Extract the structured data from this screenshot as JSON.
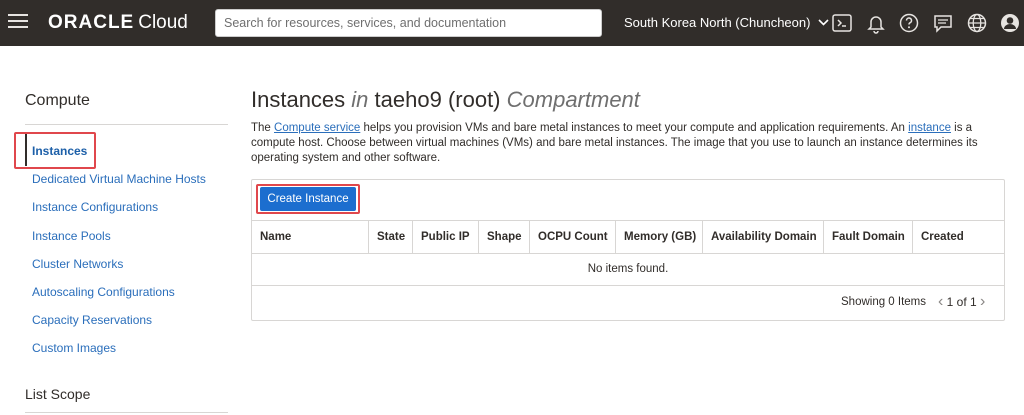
{
  "header": {
    "brand": "ORACLE",
    "product": "Cloud",
    "search_placeholder": "Search for resources, services, and documentation",
    "region": "South Korea North (Chuncheon)",
    "icons": [
      "cloud-shell-icon",
      "bell-icon",
      "help-icon",
      "chat-icon",
      "globe-icon",
      "profile-icon"
    ]
  },
  "sidebar": {
    "title": "Compute",
    "items": [
      {
        "label": "Instances",
        "active": true
      },
      {
        "label": "Dedicated Virtual Machine Hosts"
      },
      {
        "label": "Instance Configurations"
      },
      {
        "label": "Instance Pools"
      },
      {
        "label": "Cluster Networks"
      },
      {
        "label": "Autoscaling Configurations"
      },
      {
        "label": "Capacity Reservations"
      },
      {
        "label": "Custom Images"
      }
    ],
    "scope_title": "List Scope"
  },
  "main": {
    "title_a": "Instances",
    "title_in": "in",
    "title_b": "taeho9 (root)",
    "title_c": "Compartment",
    "desc_1": "The ",
    "desc_link_1": "Compute service",
    "desc_2": " helps you provision VMs and bare metal instances to meet your compute and application requirements. An ",
    "desc_link_2": "instance",
    "desc_3": " is a compute host. Choose between virtual machines (VMs) and bare metal instances. The image that you use to launch an instance determines its operating system and other software.",
    "create_button": "Create Instance",
    "columns": [
      "Name",
      "State",
      "Public IP",
      "Shape",
      "OCPU Count",
      "Memory (GB)",
      "Availability Domain",
      "Fault Domain",
      "Created"
    ],
    "empty_text": "No items found.",
    "showing": "Showing 0 Items",
    "page": "1 of 1"
  },
  "colors": {
    "accent": "#1c6ecf",
    "link": "#2a6ebb",
    "highlight": "#e0474c",
    "topbar": "#312d2a"
  }
}
